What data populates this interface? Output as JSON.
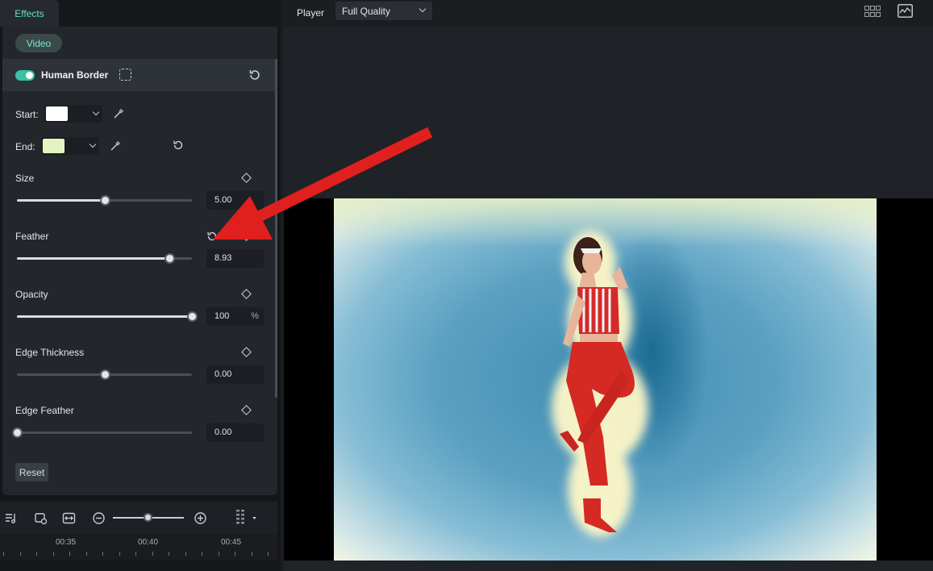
{
  "tabs": {
    "effects": "Effects"
  },
  "panel": {
    "category": "Video",
    "effect_name": "Human Border",
    "enabled": true,
    "start_label": "Start:",
    "start_color": "#ffffff",
    "end_label": "End:",
    "end_color": "#e3f4c0",
    "params": [
      {
        "label": "Size",
        "value": "5.00",
        "unit": "",
        "fraction": 0.5
      },
      {
        "label": "Feather",
        "value": "8.93",
        "unit": "",
        "fraction": 0.87
      },
      {
        "label": "Opacity",
        "value": "100",
        "unit": "%",
        "fraction": 1.0
      },
      {
        "label": "Edge Thickness",
        "value": "0.00",
        "unit": "",
        "fraction": 0.5
      },
      {
        "label": "Edge Feather",
        "value": "0.00",
        "unit": "",
        "fraction": 0.0
      }
    ],
    "reset_label": "Reset"
  },
  "timeline": {
    "ticks": [
      "00:35",
      "00:40",
      "00:45"
    ],
    "zoom_fraction": 0.5
  },
  "player": {
    "title": "Player",
    "quality": "Full Quality"
  },
  "colors": {
    "accent": "#36c3a5",
    "annotation_arrow": "#e0201f"
  },
  "icons": [
    "mask-icon",
    "reset-icon",
    "eyedropper-icon",
    "keyframe-diamond-icon",
    "grid-layout-icon",
    "scope-icon",
    "zoom-out-icon",
    "zoom-in-icon"
  ]
}
